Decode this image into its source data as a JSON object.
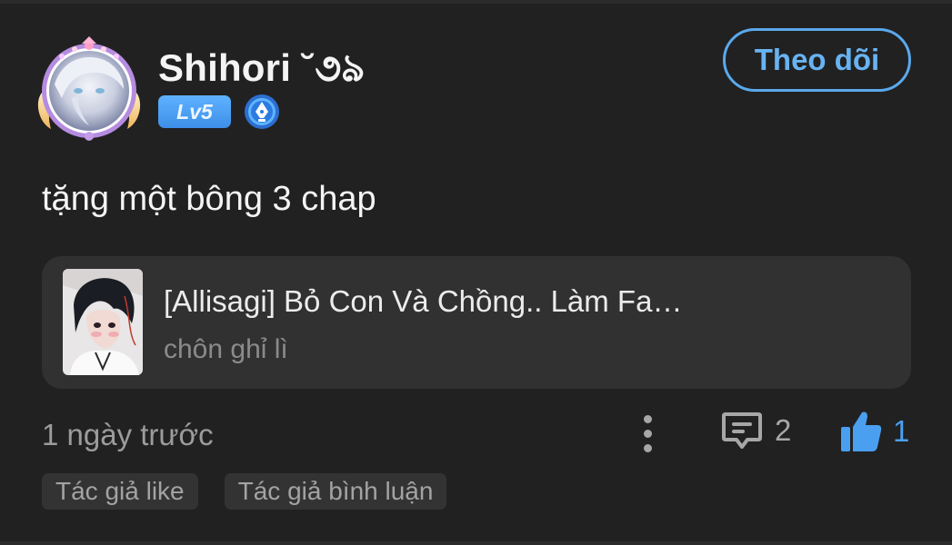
{
  "user": {
    "name": "Shihori ˘૭ঌ",
    "level": "Lv5",
    "follow_label": "Theo dõi"
  },
  "comment": {
    "text": "tặng một bông 3 chap"
  },
  "story": {
    "title": "[Allisagi] Bỏ Con Và Chồng.. Làm Fa…",
    "subtitle": "chôn ghỉ lì"
  },
  "footer": {
    "time": "1 ngày trước",
    "comment_count": "2",
    "like_count": "1",
    "tags": [
      "Tác giả like",
      "Tác giả bình luận"
    ]
  },
  "colors": {
    "background": "#212121",
    "accent": "#4a9ff0",
    "card": "#313131",
    "level_badge": "#4b9ff0"
  },
  "icons": [
    "avatar-frame",
    "pen-badge-icon",
    "more-vertical-icon",
    "comment-icon",
    "thumbs-up-icon"
  ]
}
